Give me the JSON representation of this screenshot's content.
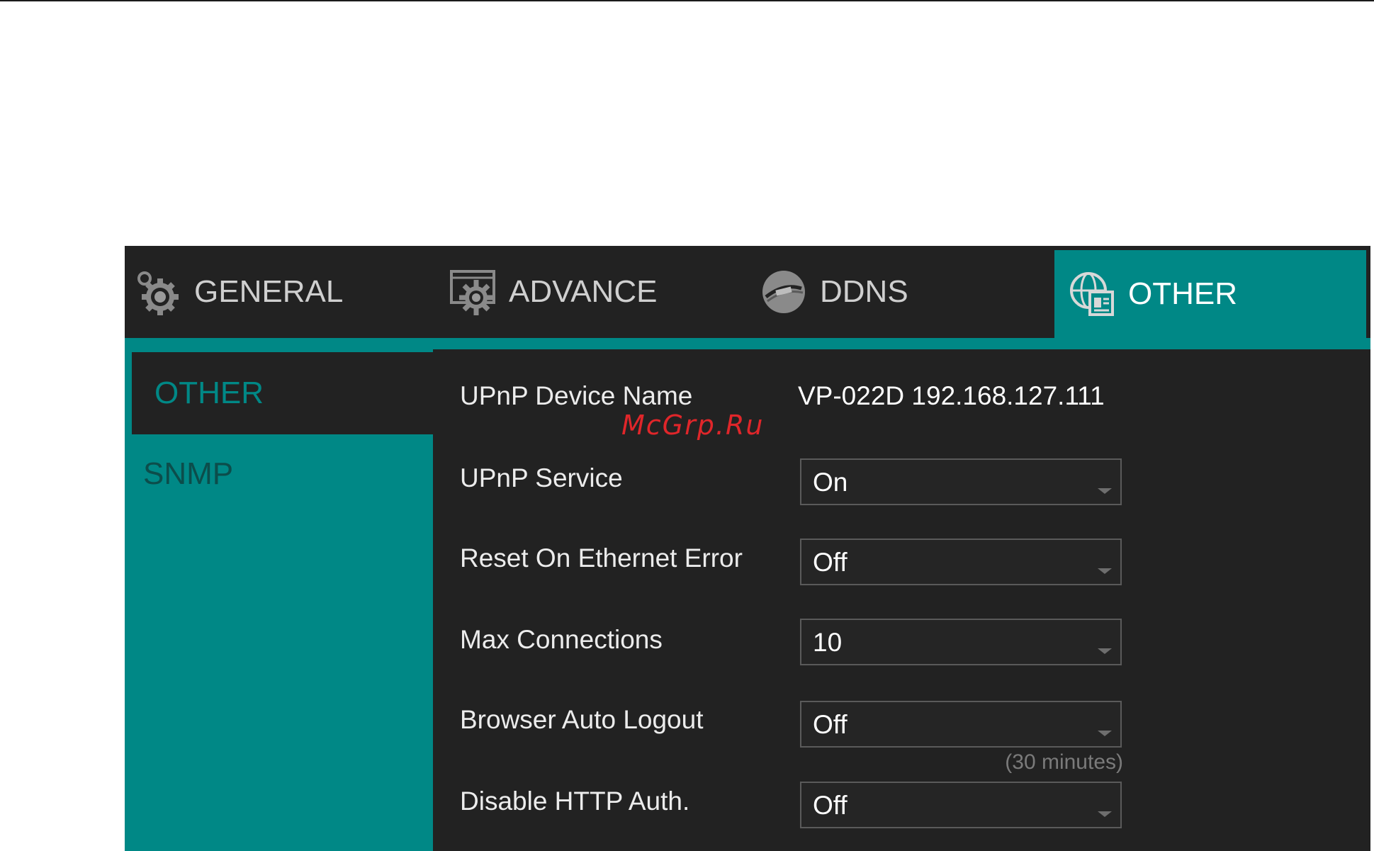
{
  "tabs": [
    {
      "label": "GENERAL",
      "icon": "gear-icon"
    },
    {
      "label": "ADVANCE",
      "icon": "advanced-settings-icon"
    },
    {
      "label": "DDNS",
      "icon": "ddns-globe-icon"
    },
    {
      "label": "OTHER",
      "icon": "globe-document-icon",
      "active": true
    }
  ],
  "sidebar": {
    "items": [
      {
        "label": "OTHER",
        "active": true
      },
      {
        "label": "SNMP"
      }
    ]
  },
  "form": {
    "upnp_device_name": {
      "label": "UPnP Device Name",
      "value": "VP-022D 192.168.127.111"
    },
    "upnp_service": {
      "label": "UPnP Service",
      "value": "On"
    },
    "reset_on_ethernet_error": {
      "label": "Reset On Ethernet Error",
      "value": "Off"
    },
    "max_connections": {
      "label": "Max Connections",
      "value": "10"
    },
    "browser_auto_logout": {
      "label": "Browser Auto Logout",
      "value": "Off",
      "hint": "(30 minutes)"
    },
    "disable_http_auth": {
      "label": "Disable HTTP Auth.",
      "value": "Off"
    }
  },
  "watermark": "McGrp.Ru",
  "colors": {
    "accent": "#008886",
    "panel": "#222222",
    "sidebar_text": "#0c4d4b"
  }
}
